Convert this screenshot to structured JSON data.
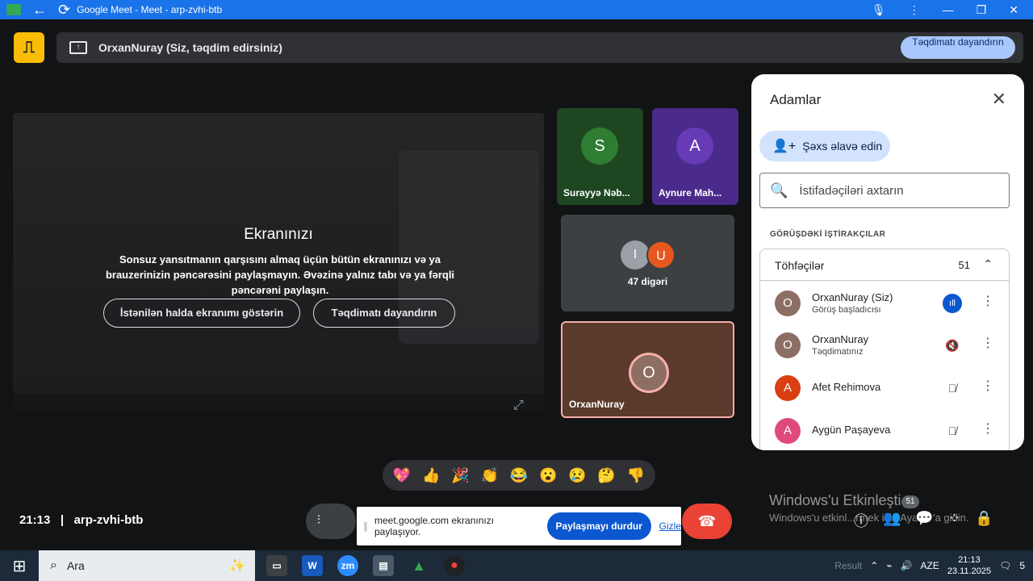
{
  "titlebar": {
    "title": "Google Meet - Meet - arp-zvhi-btb",
    "back": "←",
    "reload": "⟳",
    "mic": "🎙",
    "menu": "⋮",
    "minimize": "—",
    "maximize": "❐",
    "close": "✕"
  },
  "present_bar": {
    "label": "OrxanNuray (Siz, təqdim edirsiniz)",
    "stop_label": "Təqdimatı dayandırın"
  },
  "share_preview": {
    "title": "Ekranınızı",
    "description": "Sonsuz yansıtmanın qarşısını almaq üçün bütün ekranınızı və ya brauzerinizin pəncərəsini paylaşmayın. Əvəzinə yalnız tabı və ya fərqli pəncərəni paylaşın.",
    "show_anyway": "İstənilən halda ekranımı göstərin",
    "stop_presenting": "Təqdimatı dayandırın"
  },
  "tiles": [
    {
      "initial": "S",
      "name": "Surayyə Nəb..."
    },
    {
      "initial": "A",
      "name": "Aynure Mah..."
    }
  ],
  "others_tile": {
    "initials": [
      "I",
      "U"
    ],
    "label": "47 digəri"
  },
  "self_tile": {
    "initial": "O",
    "name": "OrxanNuray"
  },
  "people": {
    "title": "Adamlar",
    "add_label": "Şəxs əlavə edin",
    "search_placeholder": "İstifadəçiləri axtarın",
    "section": "GÖRÜŞDƏKİ İŞTİRAKÇILAR",
    "group_label": "Töhfəçilər",
    "group_count": "51",
    "list": [
      {
        "initial": "O",
        "name": "OrxanNuray (Siz)",
        "role": "Görüş başladıcısı",
        "color": "#8d6e63"
      },
      {
        "initial": "O",
        "name": "OrxanNuray",
        "role": "Təqdimatınız",
        "color": "#8d6e63"
      },
      {
        "initial": "A",
        "name": "Afet Rehimova",
        "role": "",
        "color": "#d93f12"
      },
      {
        "initial": "A",
        "name": "Aygün Paşayeva",
        "role": "",
        "color": "#e04a7a"
      }
    ]
  },
  "reactions": [
    "💖",
    "👍",
    "🎉",
    "👏",
    "😂",
    "😮",
    "😢",
    "🤔",
    "👎"
  ],
  "meeting": {
    "time": "21:13",
    "code": "arp-zvhi-btb"
  },
  "share_notice": {
    "text": "meet.google.com ekranınızı paylaşıyor.",
    "stop": "Paylaşmayı durdur",
    "hide": "Gizle"
  },
  "participants_badge": "51",
  "watermark": {
    "line1": "Windows'u Etkinleşti",
    "line2": "Windows'u etkinl...rmek için Ayarlar'a gidin."
  },
  "taskbar": {
    "search_text": "Ara",
    "result": "Result",
    "lang": "AZE",
    "time": "21:13",
    "date": "23.11.2025",
    "notifications": "5"
  }
}
